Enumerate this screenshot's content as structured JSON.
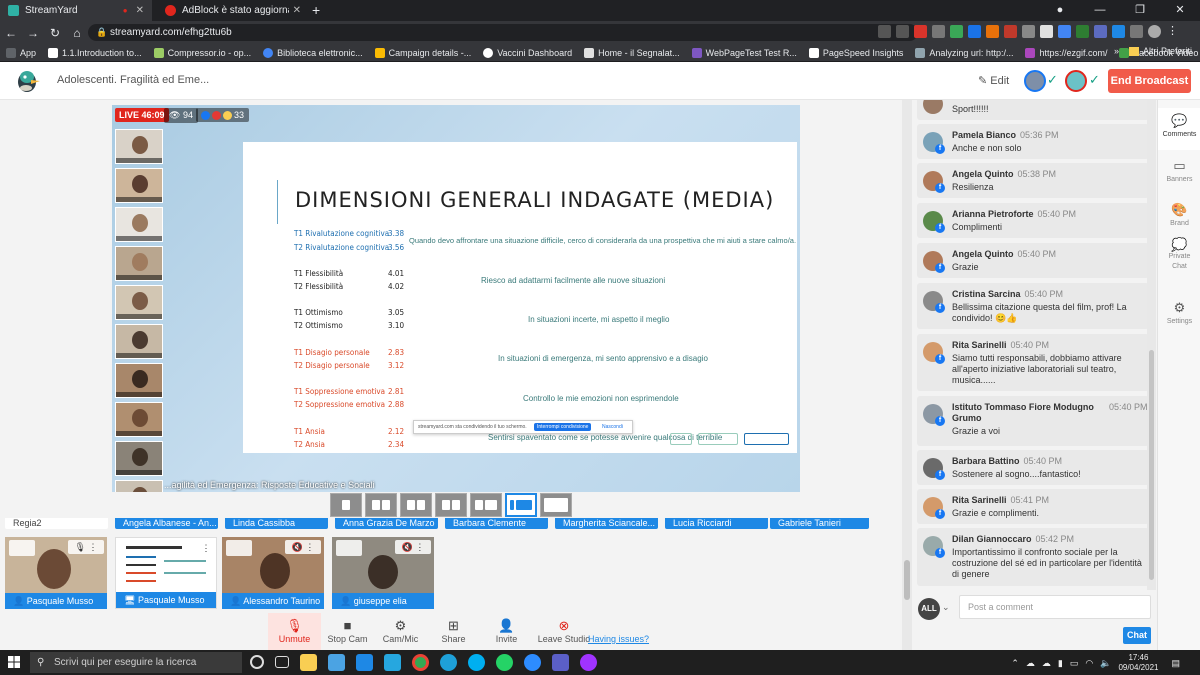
{
  "browser": {
    "tabs": [
      {
        "title": "StreamYard",
        "active": true
      },
      {
        "title": "AdBlock è stato aggiornato!",
        "active": false
      }
    ],
    "url": "streamyard.com/efhg2ttu6b",
    "bookmarks": [
      "App",
      "1.1.Introduction to...",
      "Compressor.io - op...",
      "Biblioteca elettronic...",
      "Campaign details -...",
      "Vaccini Dashboard",
      "Home - il Segnalat...",
      "WebPageTest Test R...",
      "PageSpeed Insights",
      "Analyzing url: http:/...",
      "https://ezgif.com/",
      "Facebook Video Do..."
    ],
    "bookmarks_more": "»",
    "other_bookmarks": "Altri Preferiti"
  },
  "header": {
    "title": "Adolescenti. Fragilità ed Eme...",
    "edit_label": "Edit",
    "end_label": "End Broadcast"
  },
  "stage": {
    "live_label": "LIVE 46:09",
    "viewers": "94",
    "reactions": "33",
    "lower_third": "...agilità ed Emergenza: Risposte Educative e Sociali",
    "slide": {
      "title": "DIMENSIONI GENERALI INDAGATE (MEDIA)",
      "rows": [
        {
          "name": "T1 Rivalutazione cognitiva",
          "value": "3.38",
          "color": "blue"
        },
        {
          "name": "T2 Rivalutazione cognitiva",
          "value": "3.56",
          "color": "blue"
        },
        {
          "name": "T1 Flessibilità",
          "value": "4.01",
          "color": "black"
        },
        {
          "name": "T2 Flessibilità",
          "value": "4.02",
          "color": "black"
        },
        {
          "name": "T1 Ottimismo",
          "value": "3.05",
          "color": "black"
        },
        {
          "name": "T2 Ottimismo",
          "value": "3.10",
          "color": "black"
        },
        {
          "name": "T1 Disagio personale",
          "value": "2.83",
          "color": "red"
        },
        {
          "name": "T2 Disagio personale",
          "value": "3.12",
          "color": "red"
        },
        {
          "name": "T1 Soppressione emotiva",
          "value": "2.81",
          "color": "red"
        },
        {
          "name": "T2 Soppressione emotiva",
          "value": "2.88",
          "color": "red"
        },
        {
          "name": "T1 Ansia",
          "value": "2.12",
          "color": "red"
        },
        {
          "name": "T2 Ansia",
          "value": "2.34",
          "color": "red"
        }
      ],
      "descriptions": [
        "Quando devo affrontare una situazione difficile, cerco di considerarla da una prospettiva che mi aiuti a stare calmo/a.",
        "Riesco ad adattarmi facilmente alle nuove situazioni",
        "In situazioni incerte, mi aspetto il meglio",
        "In situazioni di emergenza, mi sento apprensivo e a disagio",
        "Controllo le mie emozioni non esprimendole",
        "Sentirsi spaventato come se potesse avvenire qualcosa di terribile"
      ],
      "screenshare": {
        "message": "streamyard.com sta condividendo il tuo schermo.",
        "stop": "Interrompi condivisione",
        "hide": "Nascondi"
      }
    }
  },
  "namestrip": [
    "Regia2",
    "Angela Albanese - An...",
    "Linda Cassibba",
    "Anna Grazia De Marzo",
    "Barbara Clemente",
    "Margherita Sciancale...",
    "Lucia Ricciardi",
    "Gabriele Tanieri"
  ],
  "backstage": [
    {
      "name": "Pasquale Musso",
      "type": "camera"
    },
    {
      "name": "Pasquale Musso",
      "type": "screen"
    },
    {
      "name": "Alessandro Taurino",
      "type": "camera"
    },
    {
      "name": "giuseppe elia",
      "type": "camera"
    }
  ],
  "controls": [
    {
      "label": "Unmute",
      "icon": "mic-off-icon"
    },
    {
      "label": "Stop Cam",
      "icon": "camera-icon"
    },
    {
      "label": "Cam/Mic",
      "icon": "gear-icon"
    },
    {
      "label": "Share",
      "icon": "share-screen-icon"
    },
    {
      "label": "Invite",
      "icon": "add-person-icon"
    },
    {
      "label": "Leave Studio",
      "icon": "close-circle-icon"
    }
  ],
  "issues_label": "Having issues?",
  "comments": [
    {
      "name": "",
      "time": "",
      "text": "Sport!!!!!!"
    },
    {
      "name": "Pamela Bianco",
      "time": "05:36 PM",
      "text": "Anche e non solo"
    },
    {
      "name": "Angela Quinto",
      "time": "05:38 PM",
      "text": "Resilienza"
    },
    {
      "name": "Arianna Pietroforte",
      "time": "05:40 PM",
      "text": "Complimenti"
    },
    {
      "name": "Angela Quinto",
      "time": "05:40 PM",
      "text": "Grazie"
    },
    {
      "name": "Cristina Sarcina",
      "time": "05:40 PM",
      "text": "Bellissima citazione questa del film, prof! La condivido! 😊👍"
    },
    {
      "name": "Rita Sarinelli",
      "time": "05:40 PM",
      "text": "Siamo tutti responsabili, dobbiamo attivare all'aperto iniziative laboratoriali sul teatro, musica......"
    },
    {
      "name": "Istituto Tommaso Fiore Modugno Grumo",
      "time": "05:40 PM",
      "text": "Grazie a voi"
    },
    {
      "name": "Barbara Battino",
      "time": "05:40 PM",
      "text": "Sostenere al sogno....fantastico!"
    },
    {
      "name": "Rita Sarinelli",
      "time": "05:41 PM",
      "text": "Grazie e complimenti."
    },
    {
      "name": "Dilan Giannoccaro",
      "time": "05:42 PM",
      "text": "Importantissimo il confronto sociale per la costruzione del sé ed in particolare per l'identità di genere"
    }
  ],
  "post": {
    "audience": "ALL",
    "placeholder": "Post a comment",
    "chat_label": "Chat"
  },
  "rail": [
    {
      "label": "Comments",
      "icon": "comment-icon",
      "active": true
    },
    {
      "label": "Banners",
      "icon": "banner-icon",
      "active": false
    },
    {
      "label": "Brand",
      "icon": "palette-icon",
      "active": false
    },
    {
      "label": "Private Chat",
      "icon": "private-chat-icon",
      "active": false
    },
    {
      "label": "Settings",
      "icon": "gear-icon",
      "active": false
    }
  ],
  "taskbar": {
    "search_placeholder": "Scrivi qui per eseguire la ricerca",
    "time": "17:46",
    "date": "09/04/2021"
  },
  "colors": {
    "accent": "#1e88e5",
    "end_broadcast": "#f15b4a",
    "live": "#e0261d"
  }
}
